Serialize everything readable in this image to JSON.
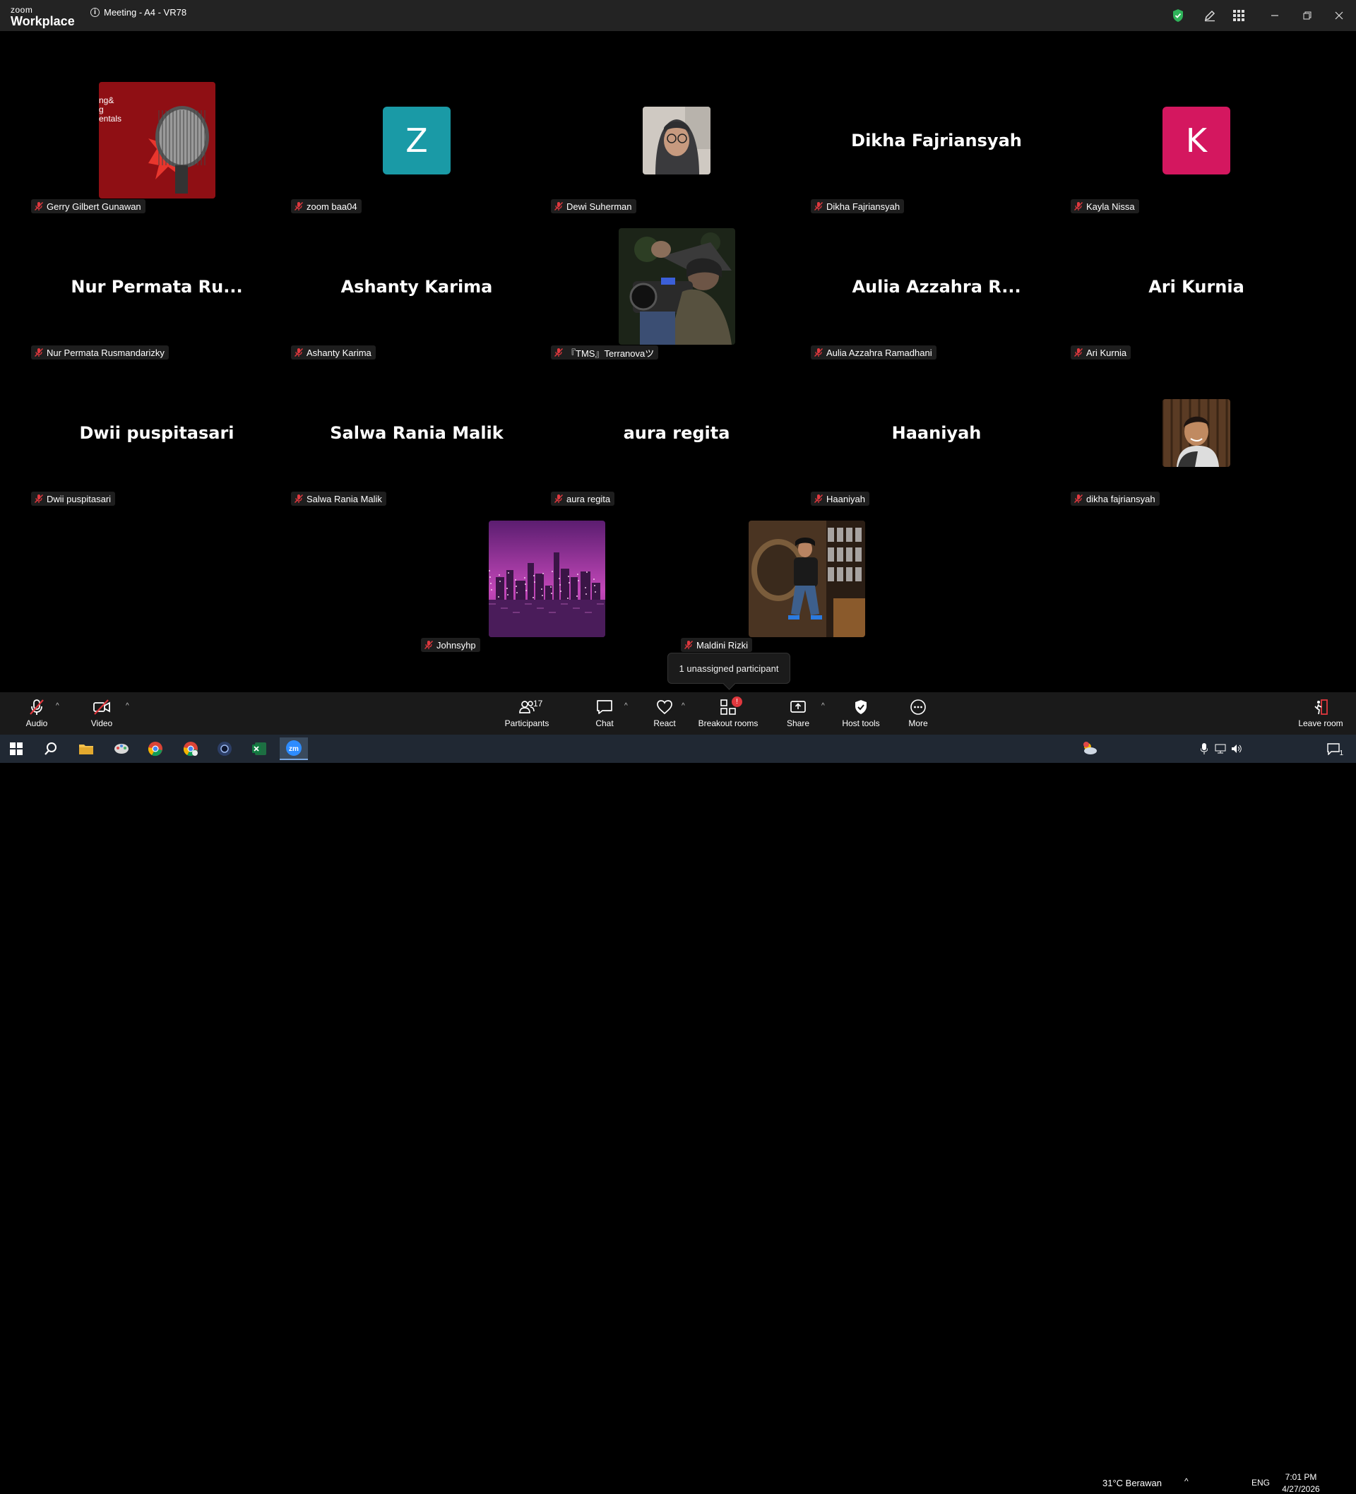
{
  "titlebar": {
    "brand_top": "zoom",
    "brand_bottom": "Workplace",
    "meeting_title": "Meeting - A4 - VR78"
  },
  "tiles": [
    {
      "display": "photo-red",
      "big": "",
      "label": "Gerry Gilbert Gunawan",
      "photo_text": "ng&\ng\nentals"
    },
    {
      "display": "letter",
      "big": "Z",
      "color": "#1a9aa6",
      "label": "zoom baa04"
    },
    {
      "display": "photo-face",
      "big": "",
      "label": "Dewi Suherman"
    },
    {
      "display": "text",
      "big": "Dikha Fajriansyah",
      "label": "Dikha Fajriansyah"
    },
    {
      "display": "letter",
      "big": "K",
      "color": "#d4175f",
      "label": "Kayla Nissa"
    },
    {
      "display": "text",
      "big": "Nur  Permata  Ru...",
      "label": "Nur Permata Rusmandarizky"
    },
    {
      "display": "text",
      "big": "Ashanty Karima",
      "label": "Ashanty Karima"
    },
    {
      "display": "photo-camera",
      "big": "",
      "label": "『TMS』Terranovaツ"
    },
    {
      "display": "text",
      "big": "Aulia  Azzahra  R...",
      "label": "Aulia Azzahra Ramadhani"
    },
    {
      "display": "text",
      "big": "Ari Kurnia",
      "label": "Ari Kurnia"
    },
    {
      "display": "text",
      "big": "Dwii puspitasari",
      "label": "Dwii puspitasari"
    },
    {
      "display": "text",
      "big": "Salwa Rania Malik",
      "label": "Salwa Rania Malik"
    },
    {
      "display": "text",
      "big": "aura regita",
      "label": "aura regita"
    },
    {
      "display": "text",
      "big": "Haaniyah",
      "label": "Haaniyah"
    },
    {
      "display": "photo-selfie",
      "big": "",
      "label": "dikha fajriansyah"
    },
    {
      "display": "photo-city",
      "big": "",
      "label": "Johnsyhp"
    },
    {
      "display": "photo-room",
      "big": "",
      "label": "Maldini Rizki"
    }
  ],
  "tooltip": "1 unassigned participant",
  "toolbar": {
    "audio": "Audio",
    "video": "Video",
    "participants": "Participants",
    "participants_count": "17",
    "chat": "Chat",
    "react": "React",
    "breakout": "Breakout rooms",
    "breakout_badge": "!",
    "share": "Share",
    "host_tools": "Host tools",
    "more": "More",
    "leave": "Leave room"
  },
  "taskbar": {
    "weather": "31°C  Berawan",
    "lang": "ENG",
    "time": "7:01 PM",
    "date": "4/27/2026",
    "notif_count": "1"
  },
  "colors": {
    "titlebar_bg": "#232323",
    "toolbar_bg": "#1a1a1a",
    "taskbar_bg": "#202833",
    "mute_red": "#e0383e",
    "shield_green": "#2fb35a"
  }
}
